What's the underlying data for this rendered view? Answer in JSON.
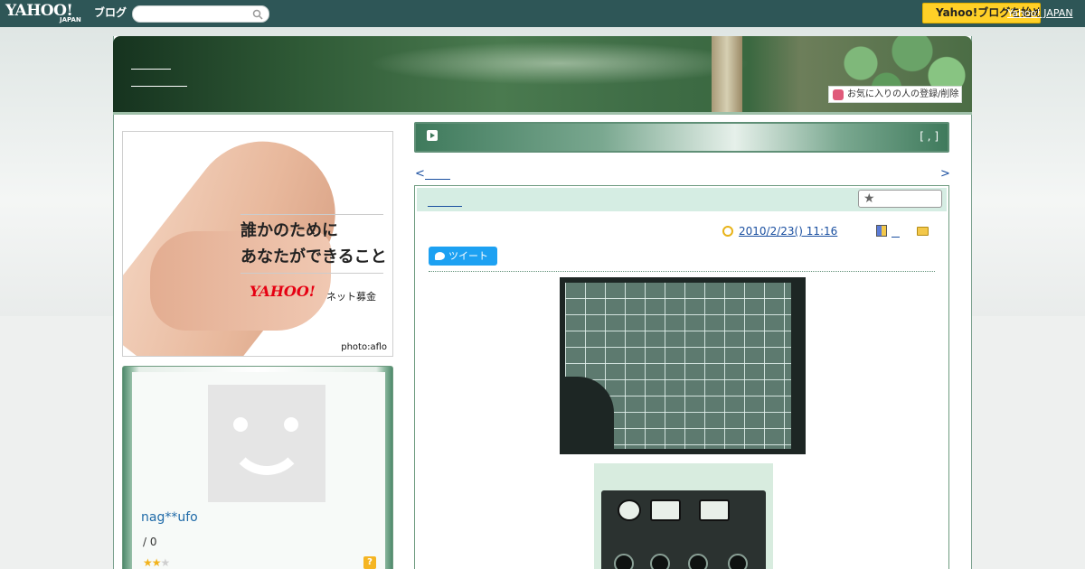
{
  "topbar": {
    "logo_yahoo": "YAHOO!",
    "logo_japan": "JAPAN",
    "logo_blog": "ブログ",
    "search_placeholder": "",
    "yahoo_button": "Yahoo!ブログを始める",
    "yahoo_japan_link": "Yahoo! JAPAN"
  },
  "header": {
    "favorite_button": "お気に入りの人の登録/削除"
  },
  "ad": {
    "line1": "誰かのために",
    "line2": "あなたができること",
    "logo": "YAHOO!",
    "logo_sub": "ネット募金",
    "photo_credit": "photo:aflo"
  },
  "profile": {
    "username": "nag**ufo",
    "count": "/ 0",
    "help_label": "?"
  },
  "category_bar": {
    "bracket": "[ , ]"
  },
  "navigation": {
    "prev_arrow": "<",
    "next_arrow": ">"
  },
  "article": {
    "date": "2010/2/23()  11:16",
    "tweet_label": "ツイート"
  },
  "colors": {
    "topbar": "#2e5657",
    "accent_green": "#5f8f76",
    "link_blue": "#1a4fa0",
    "yahoo_yellow": "#ffd027"
  }
}
